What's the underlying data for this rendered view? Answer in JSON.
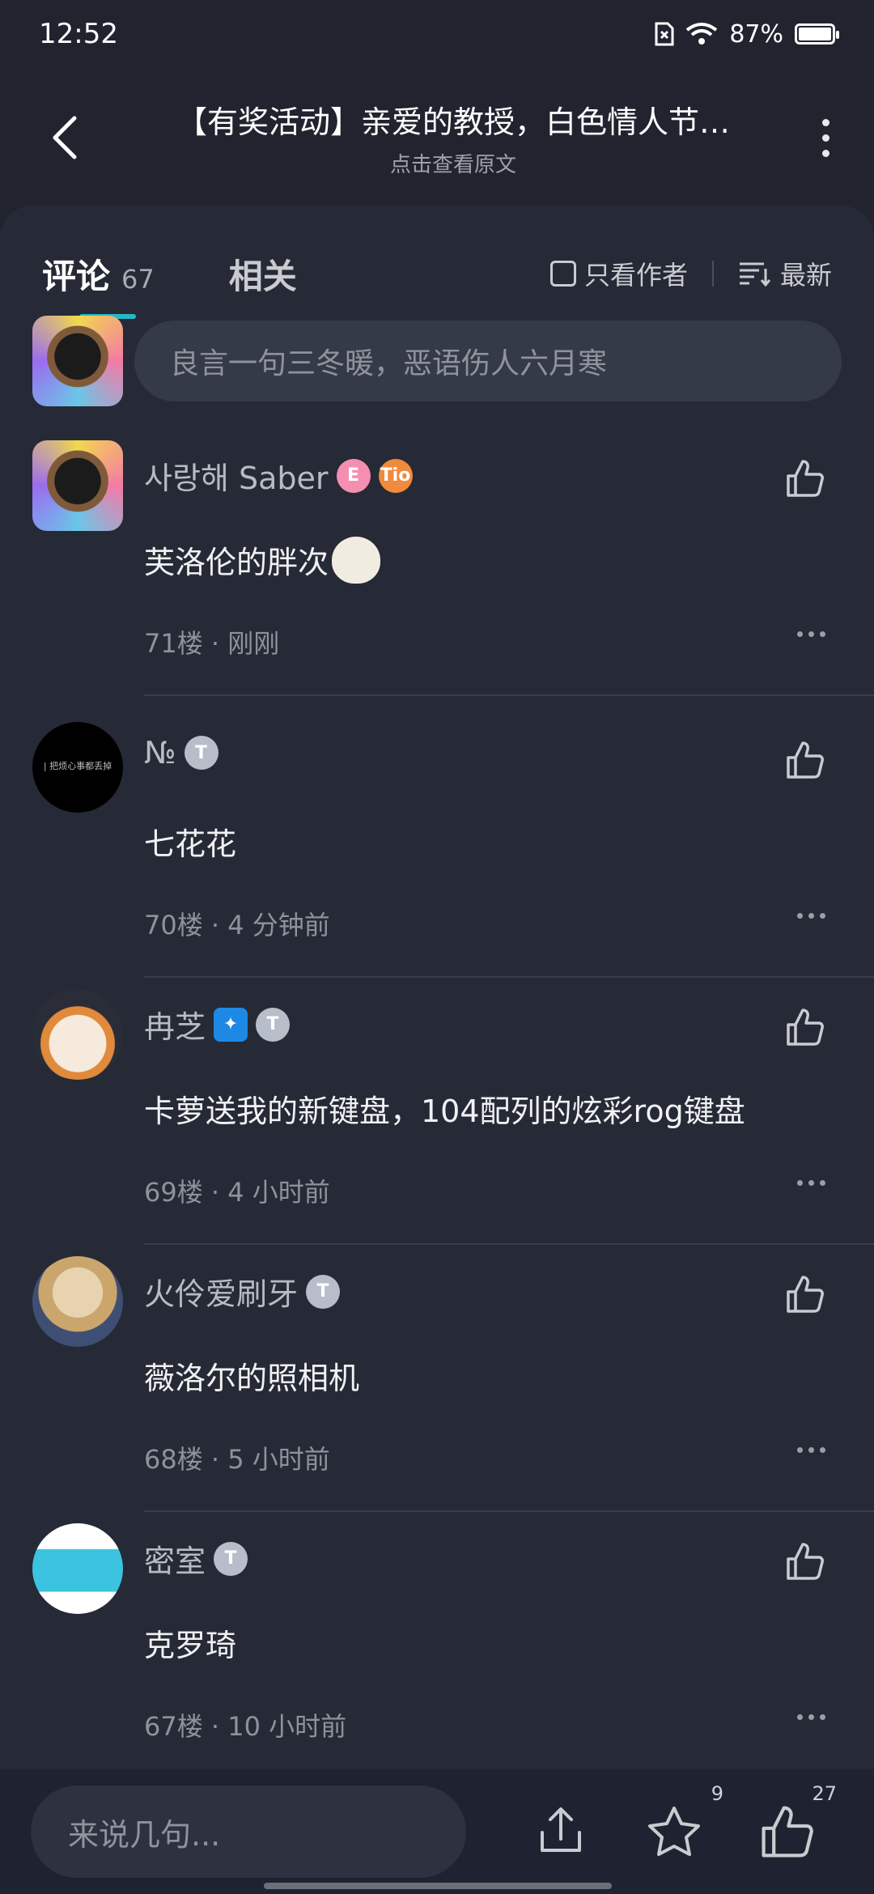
{
  "status_bar": {
    "time": "12:52",
    "battery": "87%"
  },
  "header": {
    "title": "【有奖活动】亲爱的教授，白色情人节…",
    "subtitle": "点击查看原文"
  },
  "tabs": {
    "comments_label": "评论",
    "comments_count": "67",
    "related_label": "相关",
    "author_only_label": "只看作者",
    "sort_label": "最新"
  },
  "reply_placeholder": "良言一句三冬暖，恶语伤人六月寒",
  "comments": [
    {
      "author": "사랑해 Saber",
      "text": "芙洛伦的胖次",
      "floor": "71楼",
      "time": "刚刚",
      "badges": [
        "E",
        "Tio"
      ]
    },
    {
      "author": "№",
      "text": "七花花",
      "floor": "70楼",
      "time": "4 分钟前",
      "avatar_text": "| 把烦心事都丢掉"
    },
    {
      "author": "冉芝",
      "text": "卡萝送我的新键盘，104配列的炫彩rog键盘",
      "floor": "69楼",
      "time": "4 小时前"
    },
    {
      "author": "火伶爱刷牙",
      "text": "薇洛尔的照相机",
      "floor": "68楼",
      "time": "5 小时前"
    },
    {
      "author": "密室",
      "text": "克罗琦",
      "floor": "67楼",
      "time": "10 小时前"
    }
  ],
  "bottom_bar": {
    "write_placeholder": "来说几句...",
    "star_count": "9",
    "like_count": "27"
  },
  "colors": {
    "background": "#21242f",
    "accent": "#24b8c6"
  },
  "icons": [
    "back-arrow-icon",
    "more-vertical-icon",
    "sort-icon",
    "thumb-up-icon",
    "share-icon",
    "star-icon"
  ]
}
